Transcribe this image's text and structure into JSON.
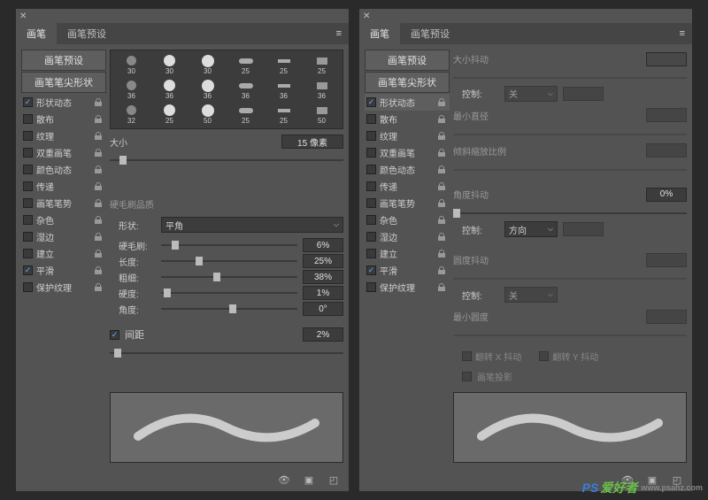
{
  "tabs": {
    "brush": "画笔",
    "presets": "画笔预设"
  },
  "sidebar": {
    "presets_btn": "画笔预设",
    "tip_btn": "画笔笔尖形状",
    "opts": [
      {
        "label": "形状动态",
        "checked": true,
        "sel": true
      },
      {
        "label": "散布",
        "checked": false
      },
      {
        "label": "纹理",
        "checked": false
      },
      {
        "label": "双重画笔",
        "checked": false
      },
      {
        "label": "颜色动态",
        "checked": false
      },
      {
        "label": "传递",
        "checked": false
      },
      {
        "label": "画笔笔势",
        "checked": false
      },
      {
        "label": "杂色",
        "checked": false
      },
      {
        "label": "湿边",
        "checked": false
      },
      {
        "label": "建立",
        "checked": false
      },
      {
        "label": "平滑",
        "checked": true
      },
      {
        "label": "保护纹理",
        "checked": false
      }
    ]
  },
  "left": {
    "preset_sizes": [
      30,
      30,
      30,
      25,
      25,
      25,
      36,
      36,
      36,
      36,
      36,
      36,
      32,
      25,
      50,
      25,
      25,
      50
    ],
    "size_label": "大小",
    "size_value": "15 像素",
    "bristle_title": "硬毛刷品质",
    "shape_label": "形状:",
    "shape_value": "平角",
    "bristle": [
      {
        "label": "硬毛刷:",
        "val": "6%",
        "pos": 8
      },
      {
        "label": "长度:",
        "val": "25%",
        "pos": 25
      },
      {
        "label": "粗细:",
        "val": "38%",
        "pos": 38
      },
      {
        "label": "硬度:",
        "val": "1%",
        "pos": 2
      },
      {
        "label": "角度:",
        "val": "0°",
        "pos": 50
      }
    ],
    "spacing_label": "间距",
    "spacing_val": "2%"
  },
  "right": {
    "size_jitter": "大小抖动",
    "control": "控制:",
    "off": "关",
    "min_diam": "最小直径",
    "tilt_scale": "倾斜缩放比例",
    "angle_jitter": "角度抖动",
    "angle_val": "0%",
    "direction": "方向",
    "round_jitter": "圆度抖动",
    "min_round": "最小圆度",
    "flipx": "翻转 X 抖动",
    "flipy": "翻转 Y 抖动",
    "proj": "画笔投影"
  },
  "watermark": {
    "brand": "爱好者",
    "site": "www.psahz.com"
  }
}
